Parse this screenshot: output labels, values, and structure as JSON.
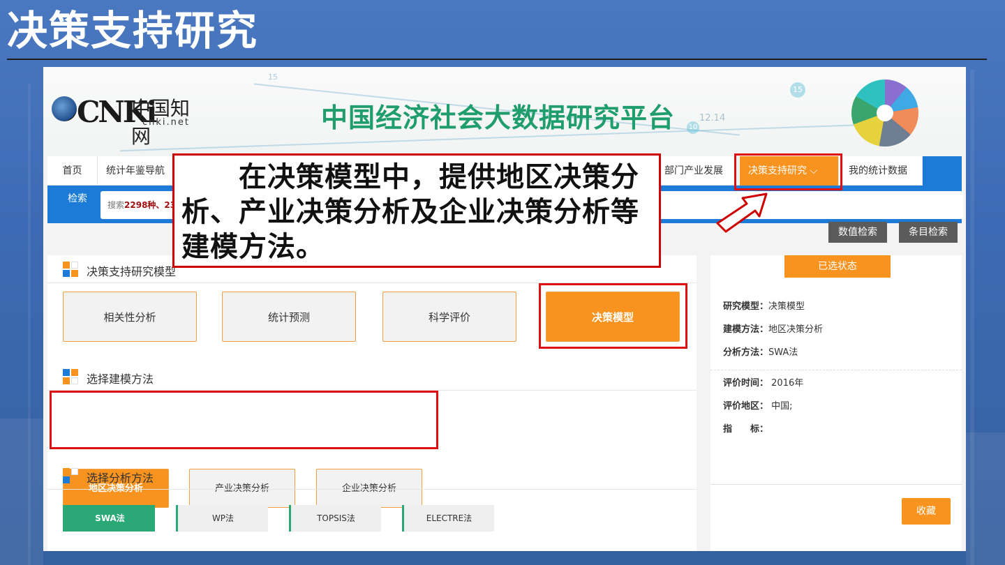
{
  "slide": {
    "title": "决策支持研究"
  },
  "header": {
    "logo_mark": "CNKi",
    "logo_cn": "中国知网",
    "logo_net": "cnki.net",
    "platform": "中国经济社会大数据研究平台",
    "deco_numbers": [
      "15",
      "15",
      "10",
      "12.14"
    ]
  },
  "nav": {
    "items": [
      "首页",
      "统计年鉴导航",
      "部门产业发展",
      "决策支持研究",
      "我的统计数据"
    ],
    "active": "决策支持研究"
  },
  "search": {
    "button": "检索",
    "placeholder_prefix": "搜索",
    "placeholder_count": "2298种、23"
  },
  "buttons": {
    "numeric_search": "数值检索",
    "item_search": "条目检索"
  },
  "sections": {
    "model": {
      "title": "决策支持研究模型",
      "options": [
        "相关性分析",
        "统计预测",
        "科学评价",
        "决策模型"
      ],
      "selected": "决策模型"
    },
    "method": {
      "title": "选择建模方法",
      "options": [
        "地区决策分析",
        "产业决策分析",
        "企业决策分析"
      ],
      "selected": "地区决策分析"
    },
    "analysis": {
      "title": "选择分析方法",
      "options": [
        "SWA法",
        "WP法",
        "TOPSIS法",
        "ELECTRE法"
      ],
      "selected": "SWA法"
    }
  },
  "state": {
    "title": "已选状态",
    "model_label": "研究模型：",
    "model_value": "决策模型",
    "method_label": "建模方法：",
    "method_value": "地区决策分析",
    "analysis_label": "分析方法：",
    "analysis_value": "SWA法",
    "time_label": "评价时间：",
    "time_value": "2016年",
    "region_label": "评价地区：",
    "region_value": "中国;",
    "indicator_label": "指　　标：",
    "fav_button": "收藏"
  },
  "callout": {
    "text": "　　在决策模型中，提供地区决策分析、产业决策分析及企业决策分析等建模方法。"
  },
  "colors": {
    "accent": "#f7931e",
    "brand_green": "#1f9d6c",
    "blue": "#1b7bd6",
    "annotation_red": "#e01010"
  }
}
